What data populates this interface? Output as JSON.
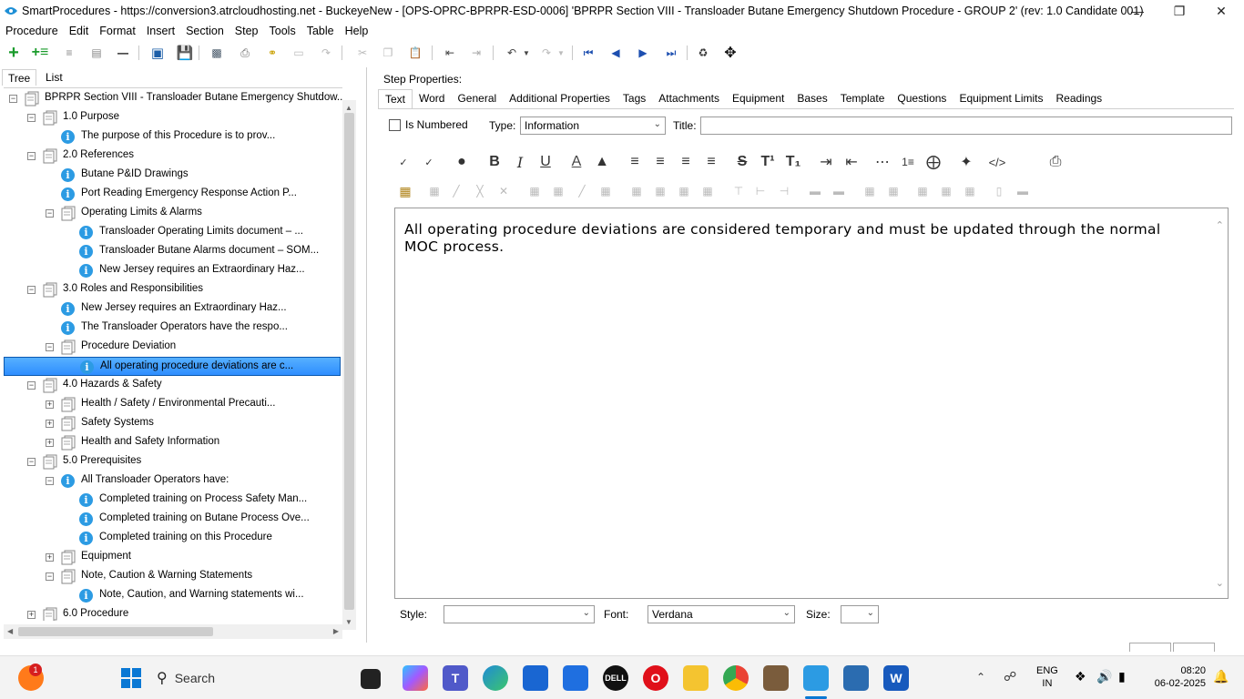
{
  "window": {
    "title": "SmartProcedures - https://conversion3.atrcloudhosting.net - BuckeyeNew - [OPS-OPRC-BPRPR-ESD-0006] 'BPRPR Section VIII - Transloader Butane Emergency Shutdown Procedure - GROUP 2' (rev: 1.0 Candidate 001)"
  },
  "menu": [
    "Procedure",
    "Edit",
    "Format",
    "Insert",
    "Section",
    "Step",
    "Tools",
    "Table",
    "Help"
  ],
  "left_tabs": [
    "Tree",
    "List"
  ],
  "tree": [
    {
      "level": 0,
      "type": "folder",
      "exp": "minus",
      "label": "BPRPR Section VIII - Transloader Butane Emergency Shutdow..."
    },
    {
      "level": 1,
      "type": "folder",
      "exp": "minus",
      "label": "1.0 Purpose"
    },
    {
      "level": 2,
      "type": "info",
      "exp": "",
      "label": "The purpose of this Procedure is to prov..."
    },
    {
      "level": 1,
      "type": "folder",
      "exp": "minus",
      "label": "2.0 References"
    },
    {
      "level": 2,
      "type": "info",
      "exp": "",
      "label": "Butane P&ID Drawings"
    },
    {
      "level": 2,
      "type": "info",
      "exp": "",
      "label": "Port Reading Emergency Response Action P..."
    },
    {
      "level": 2,
      "type": "folder",
      "exp": "minus",
      "label": "Operating Limits & Alarms"
    },
    {
      "level": 3,
      "type": "info",
      "exp": "",
      "label": "Transloader Operating Limits document – ..."
    },
    {
      "level": 3,
      "type": "info",
      "exp": "",
      "label": "Transloader Butane Alarms document – SOM..."
    },
    {
      "level": 3,
      "type": "info",
      "exp": "",
      "label": "New Jersey requires an Extraordinary Haz..."
    },
    {
      "level": 1,
      "type": "folder",
      "exp": "minus",
      "label": "3.0 Roles and Responsibilities"
    },
    {
      "level": 2,
      "type": "info",
      "exp": "",
      "label": "New Jersey requires an Extraordinary Haz..."
    },
    {
      "level": 2,
      "type": "info",
      "exp": "",
      "label": "The Transloader Operators have the respo..."
    },
    {
      "level": 2,
      "type": "folder",
      "exp": "minus",
      "label": "Procedure Deviation"
    },
    {
      "level": 3,
      "type": "info",
      "exp": "",
      "label": "All operating procedure deviations are c...",
      "selected": true
    },
    {
      "level": 1,
      "type": "folder",
      "exp": "minus",
      "label": "4.0 Hazards & Safety"
    },
    {
      "level": 2,
      "type": "folder",
      "exp": "plus",
      "label": "Health / Safety / Environmental Precauti..."
    },
    {
      "level": 2,
      "type": "folder",
      "exp": "plus",
      "label": "Safety Systems"
    },
    {
      "level": 2,
      "type": "folder",
      "exp": "plus",
      "label": "Health and Safety Information"
    },
    {
      "level": 1,
      "type": "folder",
      "exp": "minus",
      "label": "5.0 Prerequisites"
    },
    {
      "level": 2,
      "type": "info",
      "exp": "minus",
      "label": "All Transloader Operators have:"
    },
    {
      "level": 3,
      "type": "info",
      "exp": "",
      "label": "Completed training on Process Safety Man..."
    },
    {
      "level": 3,
      "type": "info",
      "exp": "",
      "label": "Completed training on Butane Process Ove..."
    },
    {
      "level": 3,
      "type": "info",
      "exp": "",
      "label": "Completed training on this Procedure"
    },
    {
      "level": 2,
      "type": "folder",
      "exp": "plus",
      "label": "Equipment"
    },
    {
      "level": 2,
      "type": "folder",
      "exp": "minus",
      "label": "Note, Caution & Warning Statements"
    },
    {
      "level": 3,
      "type": "info",
      "exp": "",
      "label": "Note, Caution, and Warning statements wi..."
    },
    {
      "level": 1,
      "type": "folder",
      "exp": "plus",
      "label": "6.0 Procedure"
    }
  ],
  "step_properties": {
    "heading": "Step Properties:",
    "tabs": [
      "Text",
      "Word",
      "General",
      "Additional Properties",
      "Tags",
      "Attachments",
      "Equipment",
      "Bases",
      "Template",
      "Questions",
      "Equipment Limits",
      "Readings"
    ],
    "is_numbered_label": "Is Numbered",
    "type_label": "Type:",
    "type_value": "Information",
    "title_label": "Title:",
    "title_value": "",
    "body_text": "All operating procedure deviations are considered temporary and must be updated through the normal MOC process.",
    "style_label": "Style:",
    "style_value": "",
    "font_label": "Font:",
    "font_value": "Verdana",
    "size_label": "Size:",
    "size_value": ""
  },
  "taskbar": {
    "search_label": "Search",
    "notification_count": "1",
    "lang_line1": "ENG",
    "lang_line2": "IN",
    "time": "08:20",
    "date": "06-02-2025"
  }
}
